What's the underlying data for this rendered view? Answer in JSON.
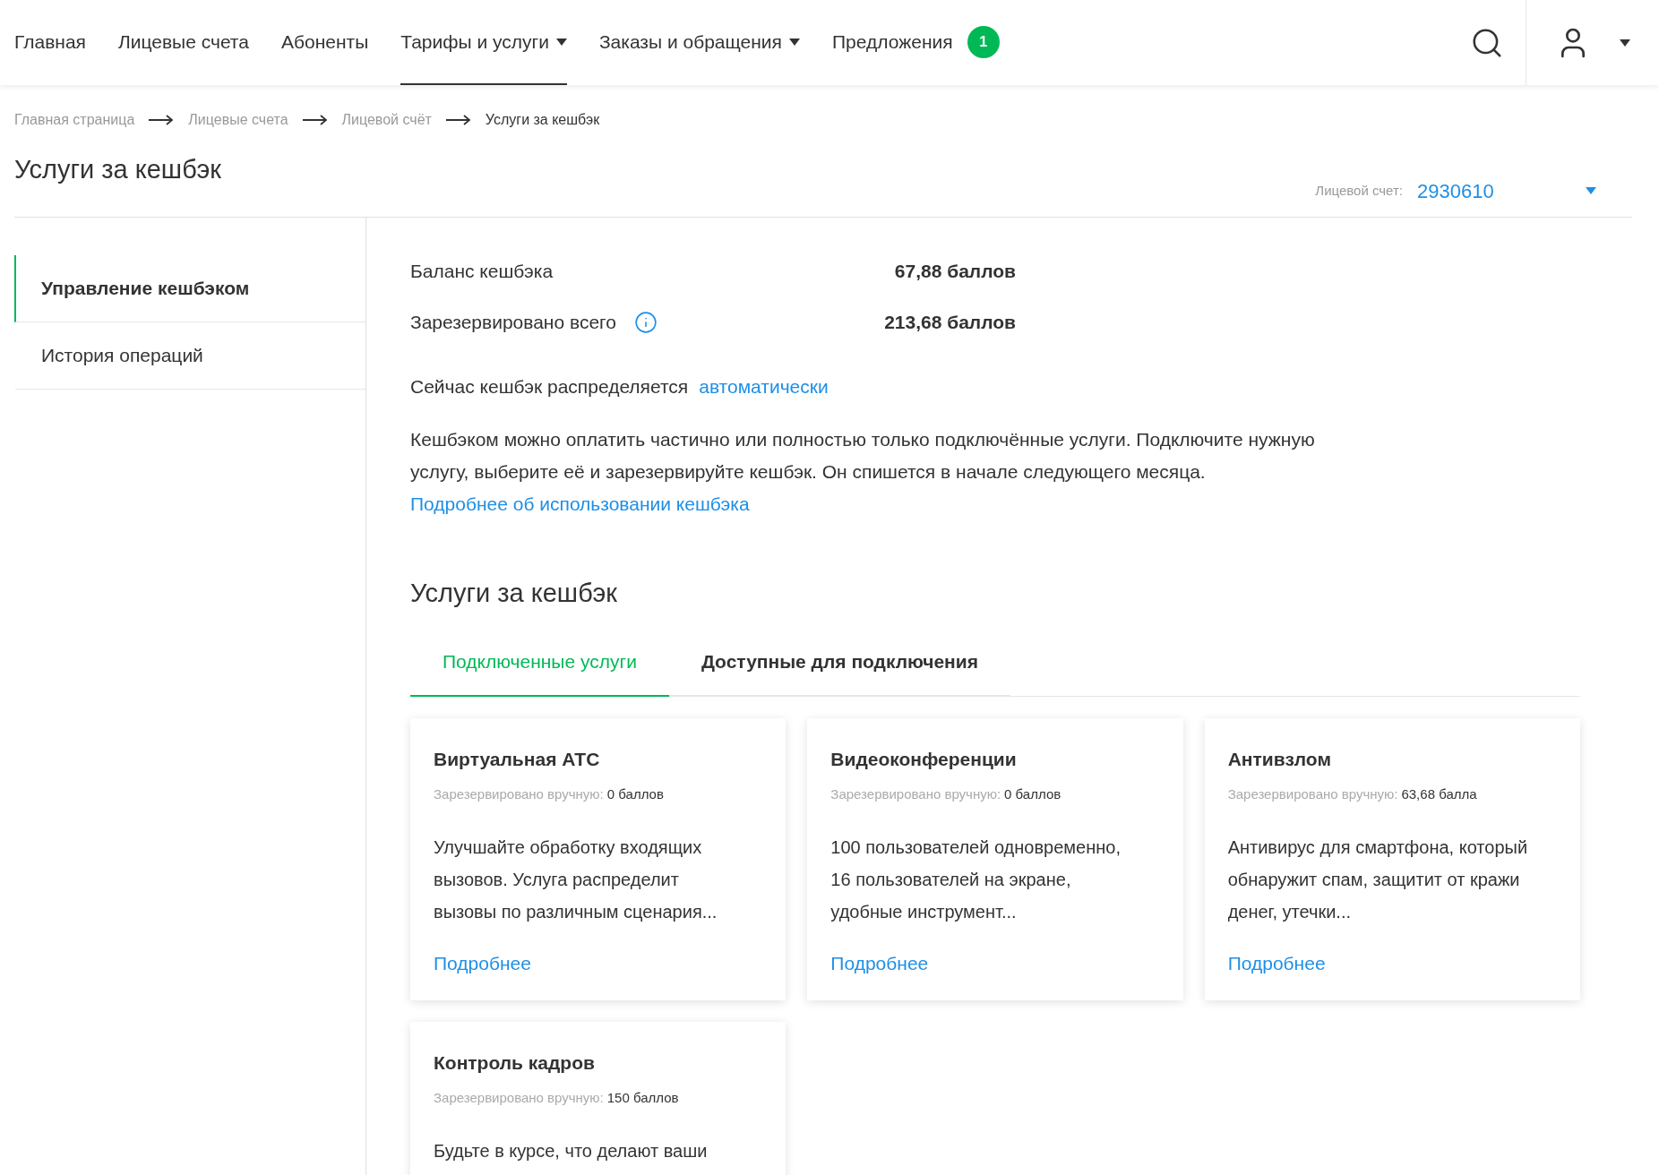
{
  "nav": {
    "items": [
      {
        "label": "Главная",
        "selected": false,
        "dropdown": false
      },
      {
        "label": "Лицевые счета",
        "selected": false,
        "dropdown": false
      },
      {
        "label": "Абоненты",
        "selected": false,
        "dropdown": false
      },
      {
        "label": "Тарифы и услуги",
        "selected": true,
        "dropdown": true
      },
      {
        "label": "Заказы и обращения",
        "selected": false,
        "dropdown": true
      },
      {
        "label": "Предложения",
        "selected": false,
        "dropdown": false,
        "badge": "1"
      }
    ]
  },
  "breadcrumbs": [
    "Главная страница",
    "Лицевые счета",
    "Лицевой счёт",
    "Услуги за кешбэк"
  ],
  "page_title": "Услуги за кешбэк",
  "account": {
    "label": "Лицевой счет:",
    "value": "2930610"
  },
  "sidebar": {
    "items": [
      {
        "label": "Управление кешбэком",
        "selected": true
      },
      {
        "label": "История операций",
        "selected": false
      }
    ]
  },
  "summary": [
    {
      "label": "Баланс кешбэка",
      "value": "67,88 баллов",
      "info": false
    },
    {
      "label": "Зарезервировано всего",
      "value": "213,68 баллов",
      "info": true
    }
  ],
  "distribution": {
    "text": "Сейчас кешбэк распределяется",
    "link": "автоматически"
  },
  "description": "Кешбэком можно оплатить частично или полностью только подключённые услуги. Подключите нужную услугу, выберите её и зарезервируйте кешбэк. Он спишется в начале следующего месяца.",
  "more_link": "Подробнее об использовании кешбэка",
  "section_title": "Услуги за кешбэк",
  "tabs": [
    {
      "label": "Подключенные услуги",
      "selected": true
    },
    {
      "label": "Доступные для подключения",
      "selected": false
    }
  ],
  "cards": [
    {
      "title": "Виртуальная АТС",
      "reserved_label": "Зарезервировано вручную:",
      "reserved_value": "0 баллов",
      "text": "Улучшайте обработку входящих вызовов. Услуга распределит вызовы по различным сценария...",
      "link": "Подробнее"
    },
    {
      "title": "Видеоконференции",
      "reserved_label": "Зарезервировано вручную:",
      "reserved_value": "0 баллов",
      "text": "100 пользователей одновременно, 16 пользователей на экране, удобные инструмент...",
      "link": "Подробнее"
    },
    {
      "title": "Антивзлом",
      "reserved_label": "Зарезервировано вручную:",
      "reserved_value": "63,68 балла",
      "text": "Антивирус для смартфона, который обнаружит спам, защитит от кражи денег, утечки...",
      "link": "Подробнее"
    },
    {
      "title": "Контроль кадров",
      "reserved_label": "Зарезервировано вручную:",
      "reserved_value": "150 баллов",
      "text": "Будьте в курсе, что делают ваши"
    }
  ]
}
